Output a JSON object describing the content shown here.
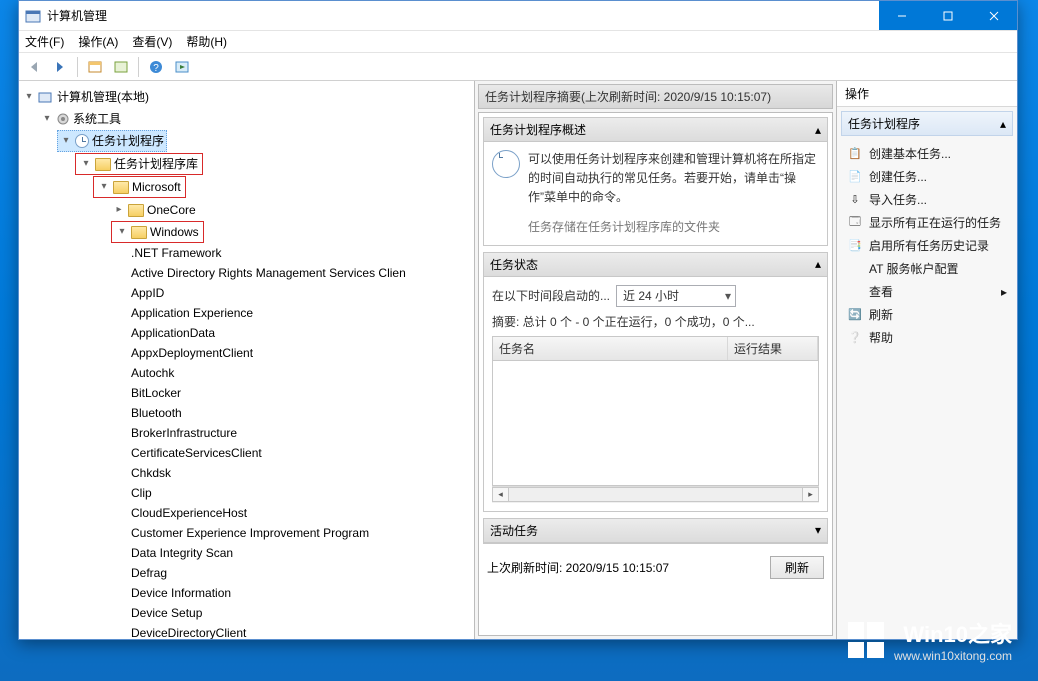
{
  "window": {
    "title": "计算机管理"
  },
  "menu": {
    "file": "文件(F)",
    "action": "操作(A)",
    "view": "查看(V)",
    "help": "帮助(H)"
  },
  "tree": {
    "root": "计算机管理(本地)",
    "systemTools": "系统工具",
    "scheduler": "任务计划程序",
    "schedulerLib": "任务计划程序库",
    "microsoft": "Microsoft",
    "onecore": "OneCore",
    "windows": "Windows",
    "children": [
      ".NET Framework",
      "Active Directory Rights Management Services Clien",
      "AppID",
      "Application Experience",
      "ApplicationData",
      "AppxDeploymentClient",
      "Autochk",
      "BitLocker",
      "Bluetooth",
      "BrokerInfrastructure",
      "CertificateServicesClient",
      "Chkdsk",
      "Clip",
      "CloudExperienceHost",
      "Customer Experience Improvement Program",
      "Data Integrity Scan",
      "Defrag",
      "Device Information",
      "Device Setup",
      "DeviceDirectoryClient"
    ]
  },
  "center": {
    "summaryHeader": "任务计划程序摘要(上次刷新时间: 2020/9/15 10:15:07)",
    "overviewTitle": "任务计划程序概述",
    "overviewText": "可以使用任务计划程序来创建和管理计算机将在所指定的时间自动执行的常见任务。若要开始，请单击“操作”菜单中的命令。",
    "overviewMore": "任务存储在任务计划程序库的文件夹",
    "statusTitle": "任务状态",
    "statusLabel": "在以下时间段启动的...",
    "statusRange": "近 24 小时",
    "statusSummary": "摘要: 总计 0 个 - 0 个正在运行，0 个成功，0 个...",
    "col1": "任务名",
    "col2": "运行结果",
    "activeTitle": "活动任务",
    "lastRefresh": "上次刷新时间: 2020/9/15 10:15:07",
    "refreshBtn": "刷新"
  },
  "actions": {
    "paneTitle": "操作",
    "section": "任务计划程序",
    "items": [
      "创建基本任务...",
      "创建任务...",
      "导入任务...",
      "显示所有正在运行的任务",
      "启用所有任务历史记录",
      "AT 服务帐户配置",
      "查看",
      "刷新",
      "帮助"
    ]
  },
  "watermark": {
    "brand": "Win10之家",
    "url": "www.win10xitong.com"
  }
}
